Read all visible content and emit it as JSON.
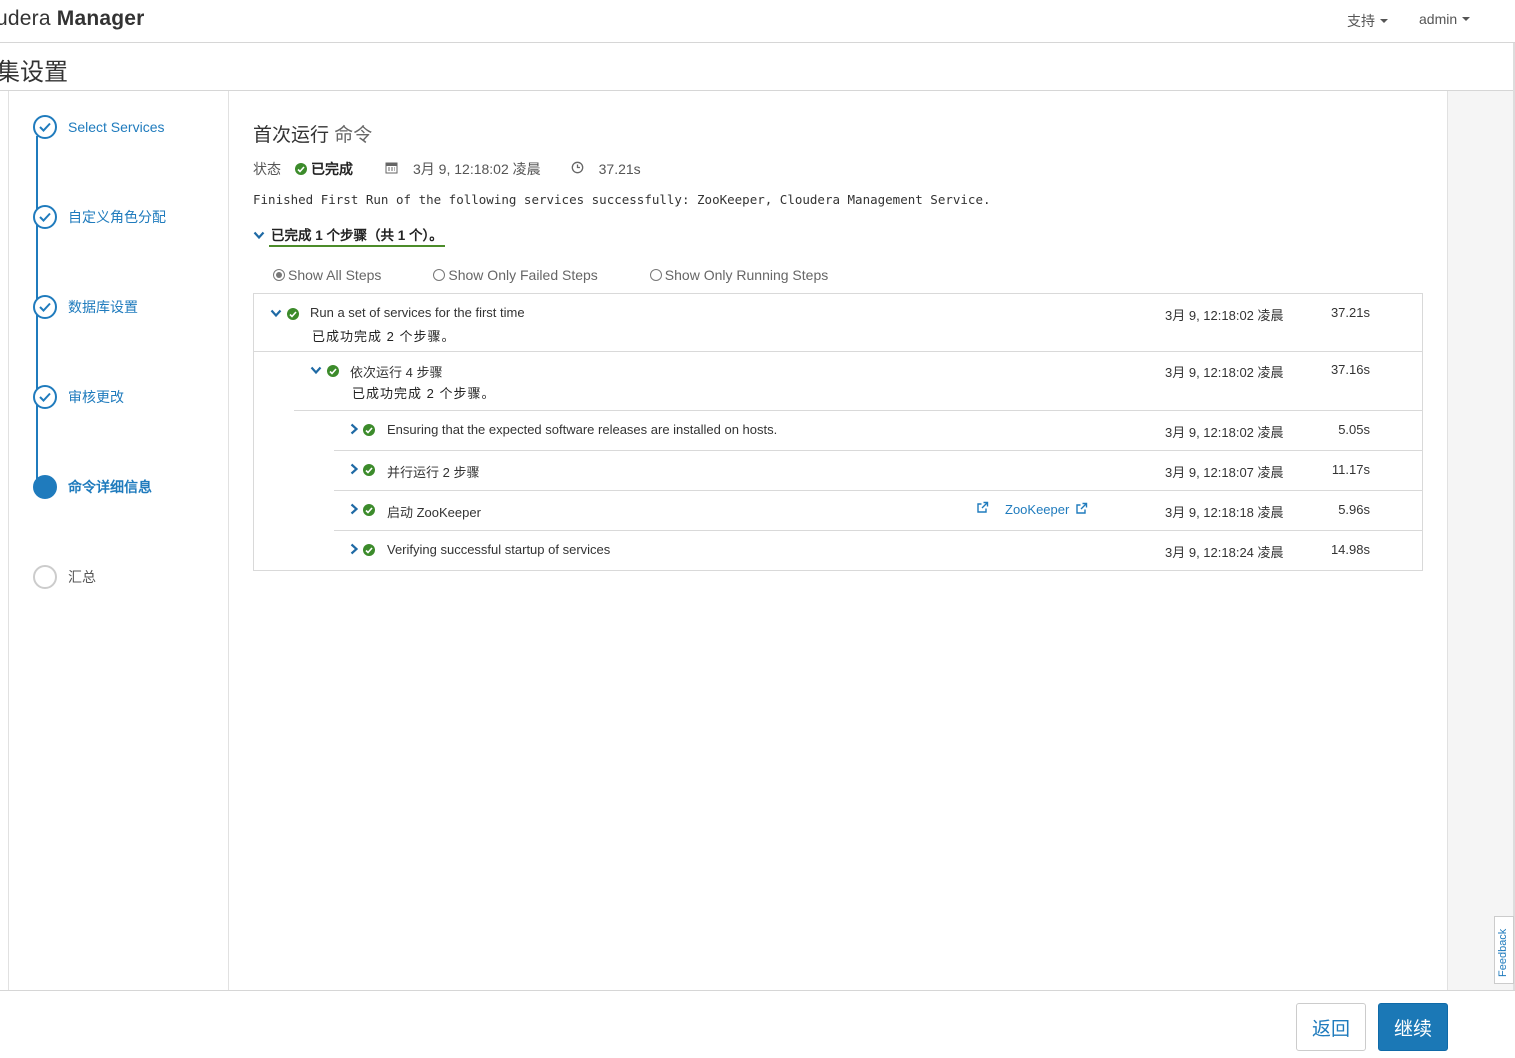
{
  "header": {
    "brand_light": "udera",
    "brand_bold": "Manager",
    "support_label": "支持",
    "user_label": "admin"
  },
  "page": {
    "title": "集设置"
  },
  "wizard": {
    "steps": [
      {
        "label": "Select Services",
        "state": "done"
      },
      {
        "label": "自定义角色分配",
        "state": "done"
      },
      {
        "label": "数据库设置",
        "state": "done"
      },
      {
        "label": "审核更改",
        "state": "done"
      },
      {
        "label": "命令详细信息",
        "state": "active"
      },
      {
        "label": "汇总",
        "state": "todo"
      }
    ]
  },
  "command": {
    "title": "首次运行",
    "title_suffix": "命令",
    "status_label": "状态",
    "status_value": "已完成",
    "start_time": "3月 9, 12:18:02 凌晨",
    "duration": "37.21s",
    "message": "Finished First Run of the following services successfully: ZooKeeper, Cloudera Management Service.",
    "summary": "已完成 1 个步骤（共 1 个）。"
  },
  "filters": {
    "all": "Show All Steps",
    "failed": "Show Only Failed Steps",
    "running": "Show Only Running Steps",
    "selected": "all"
  },
  "steps_table": {
    "rows": [
      {
        "name": "Run a set of services for the first time",
        "detail": "已成功完成 2 个步骤。",
        "time": "3月 9, 12:18:02 凌晨",
        "duration": "37.21s",
        "expanded": true
      },
      {
        "name": "依次运行 4 步骤",
        "detail": "已成功完成 2 个步骤。",
        "time": "3月 9, 12:18:02 凌晨",
        "duration": "37.16s",
        "expanded": true
      },
      {
        "name": "Ensuring that the expected software releases are installed on hosts.",
        "time": "3月 9, 12:18:02 凌晨",
        "duration": "5.05s",
        "expanded": false
      },
      {
        "name": "并行运行 2 步骤",
        "time": "3月 9, 12:18:07 凌晨",
        "duration": "11.17s",
        "expanded": false
      },
      {
        "name": "启动 ZooKeeper",
        "link": "ZooKeeper",
        "time": "3月 9, 12:18:18 凌晨",
        "duration": "5.96s",
        "expanded": false
      },
      {
        "name": "Verifying successful startup of services",
        "time": "3月 9, 12:18:24 凌晨",
        "duration": "14.98s",
        "expanded": false
      }
    ]
  },
  "footer": {
    "back_label": "返回",
    "continue_label": "继续",
    "feedback_label": "Feedback"
  },
  "colors": {
    "accent": "#1f7bbd",
    "success": "#3c8b2b",
    "primary_button": "#1b78b6"
  },
  "icons": {
    "check": "check-icon",
    "success": "success-check-icon",
    "calendar": "calendar-icon",
    "clock": "clock-icon",
    "chevron_down": "chevron-down-icon",
    "chevron_right": "chevron-right-icon",
    "external_link": "external-link-icon",
    "caret": "caret-down-icon"
  }
}
